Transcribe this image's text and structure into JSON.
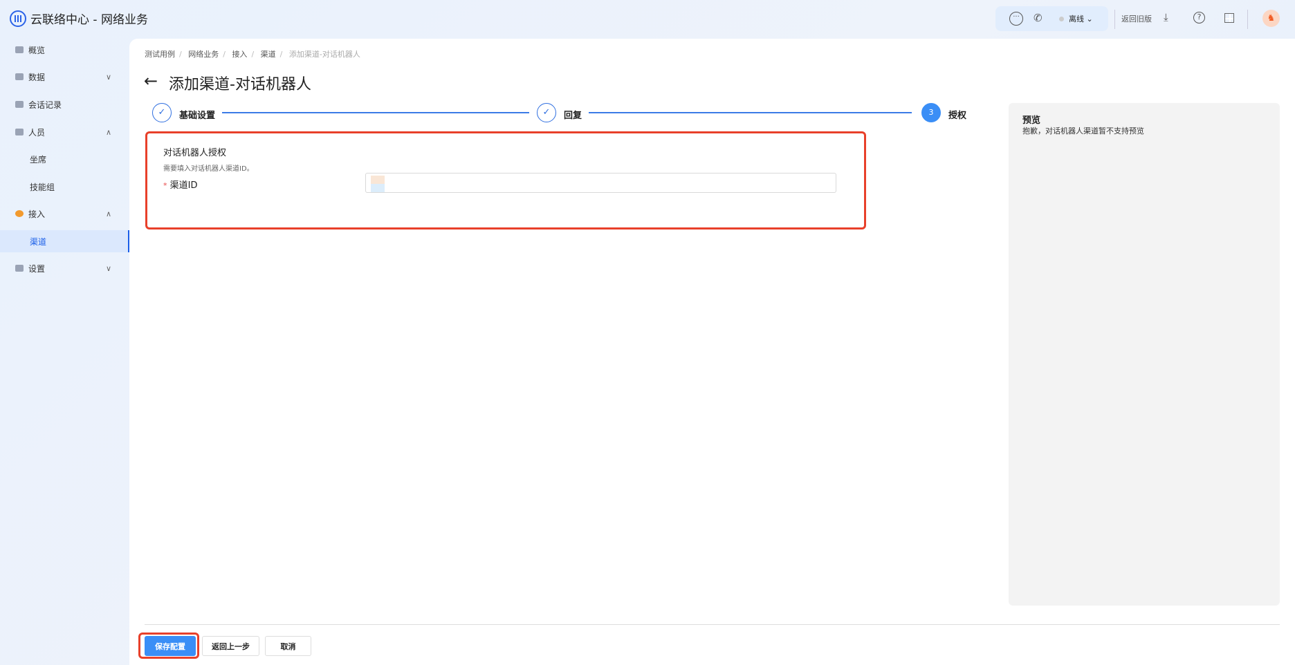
{
  "header": {
    "app_title": "云联络中心 - 网络业务",
    "status": "离线",
    "old_version": "返回旧版",
    "icons": [
      "chat-icon",
      "phone-icon",
      "download-icon",
      "help-icon",
      "apps-icon",
      "avatar"
    ]
  },
  "sidebar": {
    "items": [
      {
        "label": "概览",
        "icon": "overview-icon"
      },
      {
        "label": "数据",
        "icon": "data-icon",
        "chevron": "∨"
      },
      {
        "label": "会话记录",
        "icon": "records-icon"
      },
      {
        "label": "人员",
        "icon": "people-icon",
        "chevron": "∧"
      },
      {
        "label": "坐席",
        "sub": true
      },
      {
        "label": "技能组",
        "sub": true
      },
      {
        "label": "接入",
        "icon": "access-icon",
        "chevron": "∧"
      },
      {
        "label": "渠道",
        "sub": true,
        "active": true
      },
      {
        "label": "设置",
        "icon": "settings-icon",
        "chevron": "∨"
      }
    ]
  },
  "breadcrumb": [
    "测试用例",
    "网络业务",
    "接入",
    "渠道",
    "添加渠道-对话机器人"
  ],
  "page_title": "添加渠道-对话机器人",
  "steps": [
    {
      "label": "基础设置",
      "status": "done",
      "mark": "✓"
    },
    {
      "label": "回复",
      "status": "done",
      "mark": "✓"
    },
    {
      "label": "授权",
      "status": "current",
      "mark": "3"
    }
  ],
  "form": {
    "section_title": "对话机器人授权",
    "hint": "需要填入对话机器人渠道ID。",
    "field_label": "渠道ID",
    "required_mark": "*",
    "value": ""
  },
  "preview": {
    "title": "预览",
    "text": "抱歉，对话机器人渠道暂不支持预览"
  },
  "footer": {
    "save": "保存配置",
    "back": "返回上一步",
    "cancel": "取消"
  },
  "colors": {
    "accent": "#3a8ef6",
    "highlight": "#e8402a"
  }
}
